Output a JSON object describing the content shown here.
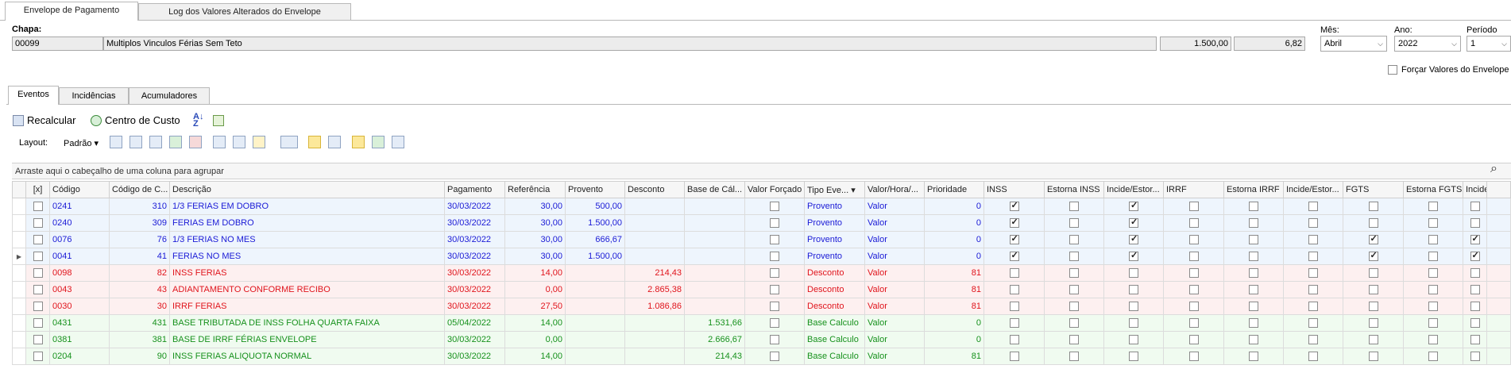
{
  "tabs": [
    "Envelope de Pagamento",
    "Log dos Valores Alterados do Envelope"
  ],
  "header": {
    "chapa_label": "Chapa:",
    "chapa": "00099",
    "description": "Multiplos Vinculos Férias Sem Teto",
    "value1": "1.500,00",
    "value2": "6,82",
    "mes_label": "Mês:",
    "mes": "Abril",
    "ano_label": "Ano:",
    "ano": "2022",
    "periodo_label": "Período",
    "periodo": "1",
    "forcar_label": "Forçar Valores do Envelope"
  },
  "inner_tabs": [
    "Eventos",
    "Incidências",
    "Acumuladores"
  ],
  "toolbar": {
    "recalcular": "Recalcular",
    "centro_custo": "Centro de Custo",
    "layout_label": "Layout:",
    "layout_value": "Padrão"
  },
  "group_hint": "Arraste aqui o cabeçalho de uma coluna para agrupar",
  "columns": [
    "[x]",
    "Código",
    "Código de C...",
    "Descrição",
    "Pagamento",
    "Referência",
    "Provento",
    "Desconto",
    "Base de Cál...",
    "Valor Forçado",
    "Tipo Eve...",
    "Valor/Hora/...",
    "Prioridade",
    "INSS",
    "Estorna INSS",
    "Incide/Estor...",
    "IRRF",
    "Estorna IRRF",
    "Incide/Estor...",
    "FGTS",
    "Estorna FGTS",
    "Incide/Esto"
  ],
  "rows": [
    {
      "type": "prov",
      "codigo": "0241",
      "cod_c": "310",
      "descricao": "1/3 FERIAS EM DOBRO",
      "pagamento": "30/03/2022",
      "referencia": "30,00",
      "provento": "500,00",
      "desconto": "",
      "base": "",
      "tipo": "Provento",
      "vh": "Valor",
      "prioridade": "0",
      "checks": [
        1,
        0,
        1,
        0,
        0,
        0,
        0,
        0,
        0
      ]
    },
    {
      "type": "prov",
      "codigo": "0240",
      "cod_c": "309",
      "descricao": "FERIAS EM DOBRO",
      "pagamento": "30/03/2022",
      "referencia": "30,00",
      "provento": "1.500,00",
      "desconto": "",
      "base": "",
      "tipo": "Provento",
      "vh": "Valor",
      "prioridade": "0",
      "checks": [
        1,
        0,
        1,
        0,
        0,
        0,
        0,
        0,
        0
      ]
    },
    {
      "type": "prov",
      "codigo": "0076",
      "cod_c": "76",
      "descricao": "1/3 FERIAS NO MES",
      "pagamento": "30/03/2022",
      "referencia": "30,00",
      "provento": "666,67",
      "desconto": "",
      "base": "",
      "tipo": "Provento",
      "vh": "Valor",
      "prioridade": "0",
      "checks": [
        1,
        0,
        1,
        0,
        0,
        0,
        1,
        0,
        1
      ]
    },
    {
      "type": "prov",
      "codigo": "0041",
      "cod_c": "41",
      "descricao": "FERIAS NO MES",
      "pagamento": "30/03/2022",
      "referencia": "30,00",
      "provento": "1.500,00",
      "desconto": "",
      "base": "",
      "tipo": "Provento",
      "vh": "Valor",
      "prioridade": "0",
      "checks": [
        1,
        0,
        1,
        0,
        0,
        0,
        1,
        0,
        1
      ],
      "current": true
    },
    {
      "type": "desc",
      "codigo": "0098",
      "cod_c": "82",
      "descricao": "INSS FERIAS",
      "pagamento": "30/03/2022",
      "referencia": "14,00",
      "provento": "",
      "desconto": "214,43",
      "base": "",
      "tipo": "Desconto",
      "vh": "Valor",
      "prioridade": "81",
      "checks": [
        0,
        0,
        0,
        0,
        0,
        0,
        0,
        0,
        0
      ]
    },
    {
      "type": "desc",
      "codigo": "0043",
      "cod_c": "43",
      "descricao": "ADIANTAMENTO CONFORME RECIBO",
      "pagamento": "30/03/2022",
      "referencia": "0,00",
      "provento": "",
      "desconto": "2.865,38",
      "base": "",
      "tipo": "Desconto",
      "vh": "Valor",
      "prioridade": "81",
      "checks": [
        0,
        0,
        0,
        0,
        0,
        0,
        0,
        0,
        0
      ]
    },
    {
      "type": "desc",
      "codigo": "0030",
      "cod_c": "30",
      "descricao": "IRRF FERIAS",
      "pagamento": "30/03/2022",
      "referencia": "27,50",
      "provento": "",
      "desconto": "1.086,86",
      "base": "",
      "tipo": "Desconto",
      "vh": "Valor",
      "prioridade": "81",
      "checks": [
        0,
        0,
        0,
        0,
        0,
        0,
        0,
        0,
        0
      ]
    },
    {
      "type": "base",
      "codigo": "0431",
      "cod_c": "431",
      "descricao": "BASE TRIBUTADA DE INSS FOLHA QUARTA FAIXA",
      "pagamento": "05/04/2022",
      "referencia": "14,00",
      "provento": "",
      "desconto": "",
      "base": "1.531,66",
      "tipo": "Base Calculo",
      "vh": "Valor",
      "prioridade": "0",
      "checks": [
        0,
        0,
        0,
        0,
        0,
        0,
        0,
        0,
        0
      ]
    },
    {
      "type": "base",
      "codigo": "0381",
      "cod_c": "381",
      "descricao": "BASE DE IRRF FÉRIAS ENVELOPE",
      "pagamento": "30/03/2022",
      "referencia": "0,00",
      "provento": "",
      "desconto": "",
      "base": "2.666,67",
      "tipo": "Base Calculo",
      "vh": "Valor",
      "prioridade": "0",
      "checks": [
        0,
        0,
        0,
        0,
        0,
        0,
        0,
        0,
        0
      ]
    },
    {
      "type": "base",
      "codigo": "0204",
      "cod_c": "90",
      "descricao": "INSS FERIAS ALIQUOTA NORMAL",
      "pagamento": "30/03/2022",
      "referencia": "14,00",
      "provento": "",
      "desconto": "",
      "base": "214,43",
      "tipo": "Base Calculo",
      "vh": "Valor",
      "prioridade": "81",
      "checks": [
        0,
        0,
        0,
        0,
        0,
        0,
        0,
        0,
        0
      ]
    }
  ]
}
